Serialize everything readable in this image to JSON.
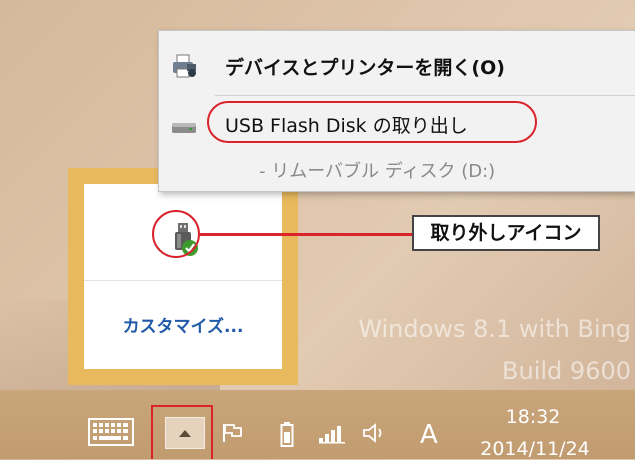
{
  "desktop": {
    "watermark_line1": "Windows 8.1 with Bing",
    "watermark_line2": "Build 9600"
  },
  "context_menu": {
    "open_devices": "デバイスとプリンターを開く(O)",
    "eject": "USB Flash Disk の取り出し",
    "sub_item": "-  リムーバブル ディスク (D:)"
  },
  "tray_flyout": {
    "customize_label": "カスタマイズ...",
    "usb_icon": "usb-safely-remove-icon"
  },
  "callout": {
    "label": "取り外しアイコン"
  },
  "taskbar": {
    "ime_label": "A",
    "time": "18:32",
    "date": "2014/11/24"
  },
  "colors": {
    "highlight": "#d9232d",
    "flyout_border": "#e8b95d",
    "link": "#1f5aa8"
  }
}
